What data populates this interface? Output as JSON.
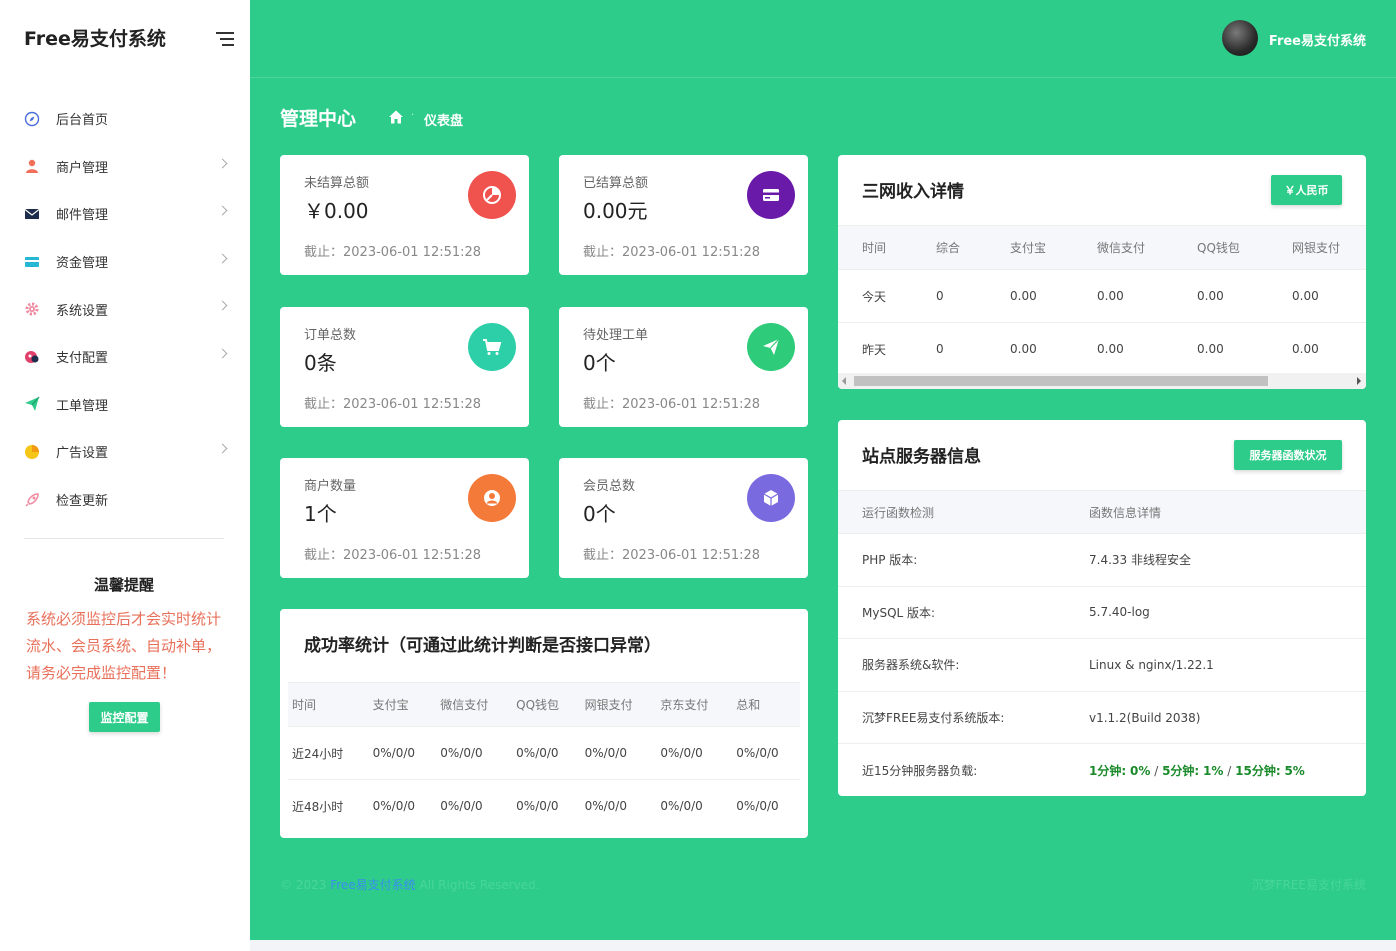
{
  "sidebar": {
    "brand": "Free易支付系统",
    "items": [
      {
        "label": "后台首页",
        "icon": "compass-icon",
        "has_arrow": false
      },
      {
        "label": "商户管理",
        "icon": "user-icon",
        "has_arrow": true
      },
      {
        "label": "邮件管理",
        "icon": "envelope-icon",
        "has_arrow": true
      },
      {
        "label": "资金管理",
        "icon": "credit-card-icon",
        "has_arrow": true
      },
      {
        "label": "系统设置",
        "icon": "gear-icon",
        "has_arrow": true
      },
      {
        "label": "支付配置",
        "icon": "payment-icon",
        "has_arrow": true
      },
      {
        "label": "工单管理",
        "icon": "paper-plane-icon",
        "has_arrow": false
      },
      {
        "label": "广告设置",
        "icon": "pie-chart-icon",
        "has_arrow": true
      },
      {
        "label": "检查更新",
        "icon": "rocket-icon",
        "has_arrow": false
      }
    ],
    "notice": {
      "title": "温馨提醒",
      "text": "系统必须监控后才会实时统计流水、会员系统、自动补单，请务必完成监控配置！",
      "button": "监控配置"
    }
  },
  "header": {
    "username": "Free易支付系统"
  },
  "page": {
    "title": "管理中心",
    "breadcrumb": "仪表盘"
  },
  "stats": [
    {
      "label": "未结算总额",
      "value": "￥0.00",
      "time": "截止：2023-06-01 12:51:28",
      "icon": "pie-chart-icon",
      "color": "#f0524e"
    },
    {
      "label": "已结算总额",
      "value": "0.00元",
      "time": "截止：2023-06-01 12:51:28",
      "icon": "credit-card-icon",
      "color": "#6a1aa8"
    },
    {
      "label": "订单总数",
      "value": "0条",
      "time": "截止：2023-06-01 12:51:28",
      "icon": "shopping-cart-icon",
      "color": "#2ccfa8"
    },
    {
      "label": "待处理工单",
      "value": "0个",
      "time": "截止：2023-06-01 12:51:28",
      "icon": "paper-plane-icon",
      "color": "#2ecc7a"
    },
    {
      "label": "商户数量",
      "value": "1个",
      "time": "截止：2023-06-01 12:51:28",
      "icon": "user-circle-icon",
      "color": "#f47a3a"
    },
    {
      "label": "会员总数",
      "value": "0个",
      "time": "截止：2023-06-01 12:51:28",
      "icon": "cube-icon",
      "color": "#7a6ae0"
    }
  ],
  "success_rate": {
    "title": "成功率统计（可通过此统计判断是否接口异常）",
    "columns": [
      "时间",
      "支付宝",
      "微信支付",
      "QQ钱包",
      "网银支付",
      "京东支付",
      "总和"
    ],
    "rows": [
      [
        "近24小时",
        "0%/0/0",
        "0%/0/0",
        "0%/0/0",
        "0%/0/0",
        "0%/0/0",
        "0%/0/0"
      ],
      [
        "近48小时",
        "0%/0/0",
        "0%/0/0",
        "0%/0/0",
        "0%/0/0",
        "0%/0/0",
        "0%/0/0"
      ]
    ]
  },
  "income": {
    "title": "三网收入详情",
    "button": "￥人民币",
    "columns": [
      "时间",
      "综合",
      "支付宝",
      "微信支付",
      "QQ钱包",
      "网银支付"
    ],
    "rows": [
      [
        "今天",
        "0",
        "0.00",
        "0.00",
        "0.00",
        "0.00"
      ],
      [
        "昨天",
        "0",
        "0.00",
        "0.00",
        "0.00",
        "0.00"
      ]
    ]
  },
  "server": {
    "title": "站点服务器信息",
    "button": "服务器函数状况",
    "columns": [
      "运行函数检测",
      "函数信息详情"
    ],
    "rows": [
      [
        "PHP 版本:",
        "7.4.33 非线程安全"
      ],
      [
        "MySQL 版本:",
        "5.7.40-log"
      ],
      [
        "服务器系统&软件:",
        "Linux & nginx/1.22.1"
      ],
      [
        "沉梦FREE易支付系统版本:",
        "v1.1.2(Build 2038)"
      ]
    ],
    "load_label": "近15分钟服务器负载:",
    "load": {
      "m1_label": "1分钟:",
      "m1": "0%",
      "m5_label": "5分钟:",
      "m5": "1%",
      "m15_label": "15分钟:",
      "m15": "5%"
    }
  },
  "footer": {
    "prefix": "© 2023",
    "link": "Free易支付系统",
    "suffix": "All Rights Reserved.",
    "right": "沉梦FREE易支付系统"
  }
}
